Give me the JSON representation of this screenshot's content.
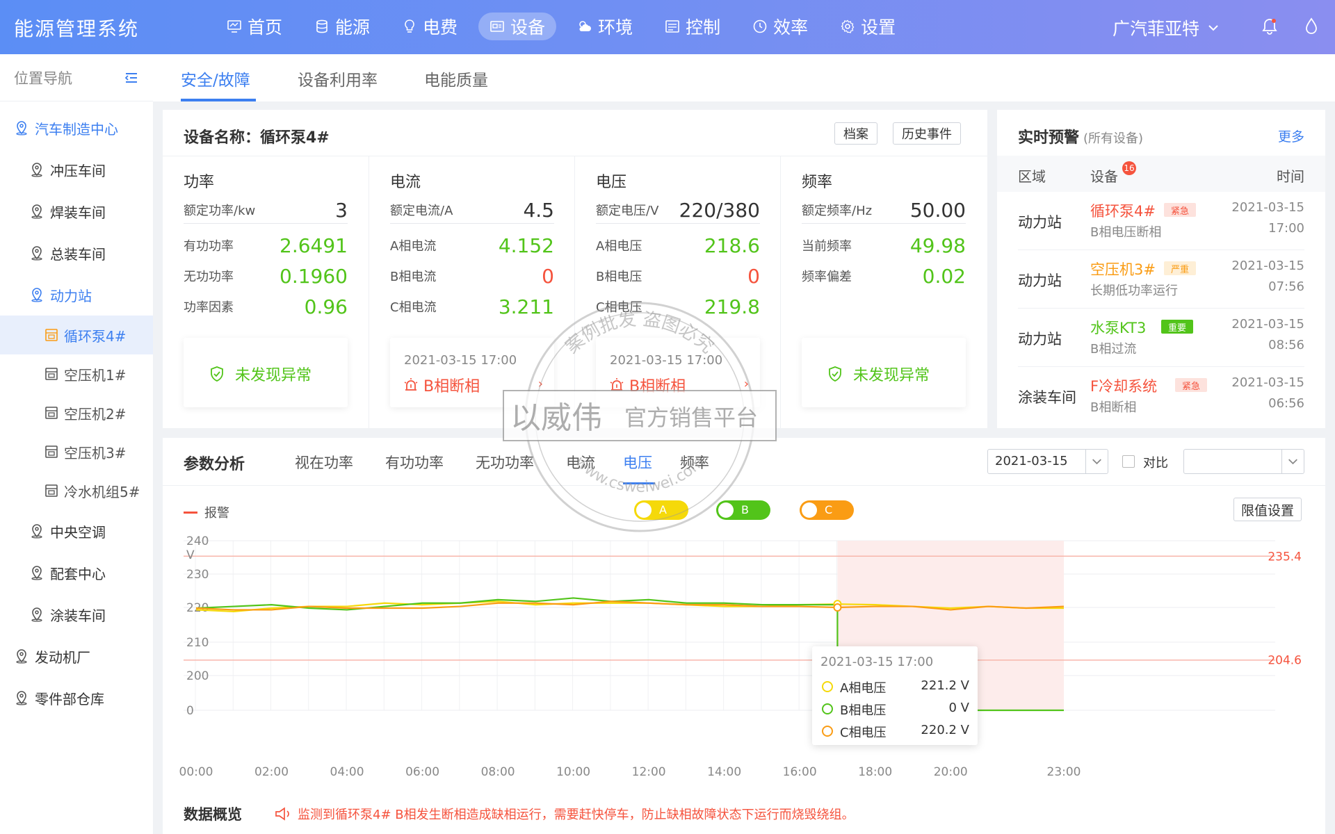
{
  "app": {
    "title": "能源管理系统",
    "company": "广汽菲亚特"
  },
  "nav": [
    "首页",
    "能源",
    "电费",
    "设备",
    "环境",
    "控制",
    "效率",
    "设置"
  ],
  "sidebar": {
    "header": "位置导航",
    "items": [
      "汽车制造中心",
      "冲压车间",
      "焊装车间",
      "总装车间",
      "动力站",
      "循环泵4#",
      "空压机1#",
      "空压机2#",
      "空压机3#",
      "冷水机组5#",
      "中央空调",
      "配套中心",
      "涂装车间",
      "发动机厂",
      "零件部仓库"
    ]
  },
  "tabs": [
    "安全/故障",
    "设备利用率",
    "电能质量"
  ],
  "device": {
    "title": "设备名称：循环泵4#",
    "btn_archive": "档案",
    "btn_history": "历史事件",
    "power": {
      "title": "功率",
      "rated_label": "额定功率/kw",
      "rated_value": "3",
      "rows": [
        {
          "label": "有功功率",
          "value": "2.6491"
        },
        {
          "label": "无功功率",
          "value": "0.1960"
        },
        {
          "label": "功率因素",
          "value": "0.96"
        }
      ],
      "status": "未发现异常"
    },
    "current": {
      "title": "电流",
      "rated_label": "额定电流/A",
      "rated_value": "4.5",
      "rows": [
        {
          "label": "A相电流",
          "value": "4.152"
        },
        {
          "label": "B相电流",
          "value": "0"
        },
        {
          "label": "C相电流",
          "value": "3.211"
        }
      ],
      "alarm_time": "2021-03-15 17:00",
      "alarm": "B相断相"
    },
    "voltage": {
      "title": "电压",
      "rated_label": "额定电压/V",
      "rated_value": "220/380",
      "rows": [
        {
          "label": "A相电压",
          "value": "218.6"
        },
        {
          "label": "B相电压",
          "value": "0"
        },
        {
          "label": "C相电压",
          "value": "219.8"
        }
      ],
      "alarm_time": "2021-03-15 17:00",
      "alarm": "B相断相"
    },
    "frequency": {
      "title": "频率",
      "rated_label": "额定频率/Hz",
      "rated_value": "50.00",
      "rows": [
        {
          "label": "当前频率",
          "value": "49.98"
        },
        {
          "label": "频率偏差",
          "value": "0.02"
        }
      ],
      "status": "未发现异常"
    }
  },
  "warnings": {
    "title": "实时预警",
    "subtitle": "(所有设备)",
    "more": "更多",
    "col_area": "区域",
    "col_device": "设备",
    "col_time": "时间",
    "badge": "16",
    "rows": [
      {
        "area": "动力站",
        "device": "循环泵4#",
        "tag": "紧急",
        "desc": "B相电压断相",
        "date": "2021-03-15",
        "time": "17:00",
        "color": "#f5533d"
      },
      {
        "area": "动力站",
        "device": "空压机3#",
        "tag": "严重",
        "desc": "长期低功率运行",
        "date": "2021-03-15",
        "time": "07:56",
        "color": "#fa9c14"
      },
      {
        "area": "动力站",
        "device": "水泵KT3",
        "tag": "重要",
        "desc": "B相过流",
        "date": "2021-03-15",
        "time": "08:56",
        "color": "#52c41a"
      },
      {
        "area": "涂装车间",
        "device": "F冷却系统",
        "tag": "紧急",
        "desc": "B相断相",
        "date": "2021-03-15",
        "time": "06:56",
        "color": "#f5533d"
      }
    ]
  },
  "analysis": {
    "title": "参数分析",
    "tabs": [
      "视在功率",
      "有功功率",
      "无功功率",
      "电流",
      "电压",
      "频率"
    ],
    "date": "2021-03-15",
    "compare": "对比",
    "alarm_legend": "报警",
    "toggles": [
      {
        "label": "A",
        "color": "#f5d90a"
      },
      {
        "label": "B",
        "color": "#52c41a"
      },
      {
        "label": "C",
        "color": "#fa9c14"
      }
    ],
    "limit_btn": "限值设置",
    "overview": "数据概览",
    "notice": "监测到循环泵4# B相发生断相造成缺相运行，需要赶快停车，防止缺相故障状态下运行而烧毁绕组。"
  },
  "chart_data": {
    "type": "line",
    "x": [
      "00:00",
      "01:00",
      "02:00",
      "03:00",
      "04:00",
      "05:00",
      "06:00",
      "07:00",
      "08:00",
      "09:00",
      "10:00",
      "11:00",
      "12:00",
      "13:00",
      "14:00",
      "15:00",
      "16:00",
      "17:00",
      "18:00",
      "19:00",
      "20:00",
      "21:00",
      "22:00",
      "23:00"
    ],
    "x_ticks": [
      "00:00",
      "02:00",
      "04:00",
      "06:00",
      "08:00",
      "10:00",
      "12:00",
      "14:00",
      "16:00",
      "18:00",
      "20:00",
      "23:00"
    ],
    "y_ticks": [
      "240",
      "230",
      "220",
      "210",
      "200",
      "0"
    ],
    "ylabel": "V",
    "limits": {
      "upper": 235.4,
      "lower": 204.6,
      "upper_label": "235.4",
      "lower_label": "204.6"
    },
    "alarm_from": "17:00",
    "series": [
      {
        "name": "A",
        "color": "#f5d90a",
        "values": [
          219.5,
          219,
          220,
          220.5,
          220.5,
          221.5,
          221,
          221.5,
          222,
          221,
          221.5,
          221.5,
          221.5,
          221,
          220.5,
          220.5,
          221,
          221.2,
          221,
          220.5,
          220,
          220.5,
          220,
          220
        ]
      },
      {
        "name": "B",
        "color": "#52c41a",
        "values": [
          220,
          220.5,
          221,
          220,
          219.5,
          220.5,
          221.5,
          221.5,
          222.5,
          222,
          223,
          222,
          222.5,
          221.5,
          221.5,
          221,
          221,
          0,
          0,
          0,
          0,
          0,
          0,
          0
        ]
      },
      {
        "name": "C",
        "color": "#fa9c14",
        "values": [
          220,
          219.5,
          219.5,
          220.5,
          220,
          220,
          220,
          220.5,
          221.5,
          221.5,
          221,
          222,
          221.5,
          221,
          221,
          220.5,
          220.5,
          220.2,
          220.5,
          220.5,
          219.5,
          220.5,
          220,
          220.5
        ]
      }
    ],
    "tooltip": {
      "time": "2021-03-15 17:00",
      "rows": [
        {
          "name": "A相电压",
          "value": "221.2 V"
        },
        {
          "name": "B相电压",
          "value": "0 V"
        },
        {
          "name": "C相电压",
          "value": "220.2 V"
        }
      ]
    }
  },
  "watermark": {
    "arc_top": "案例批发 盗图必究",
    "main": "以威伟",
    "sub": "官方销售平台",
    "url": "www.csweiwei.com"
  }
}
